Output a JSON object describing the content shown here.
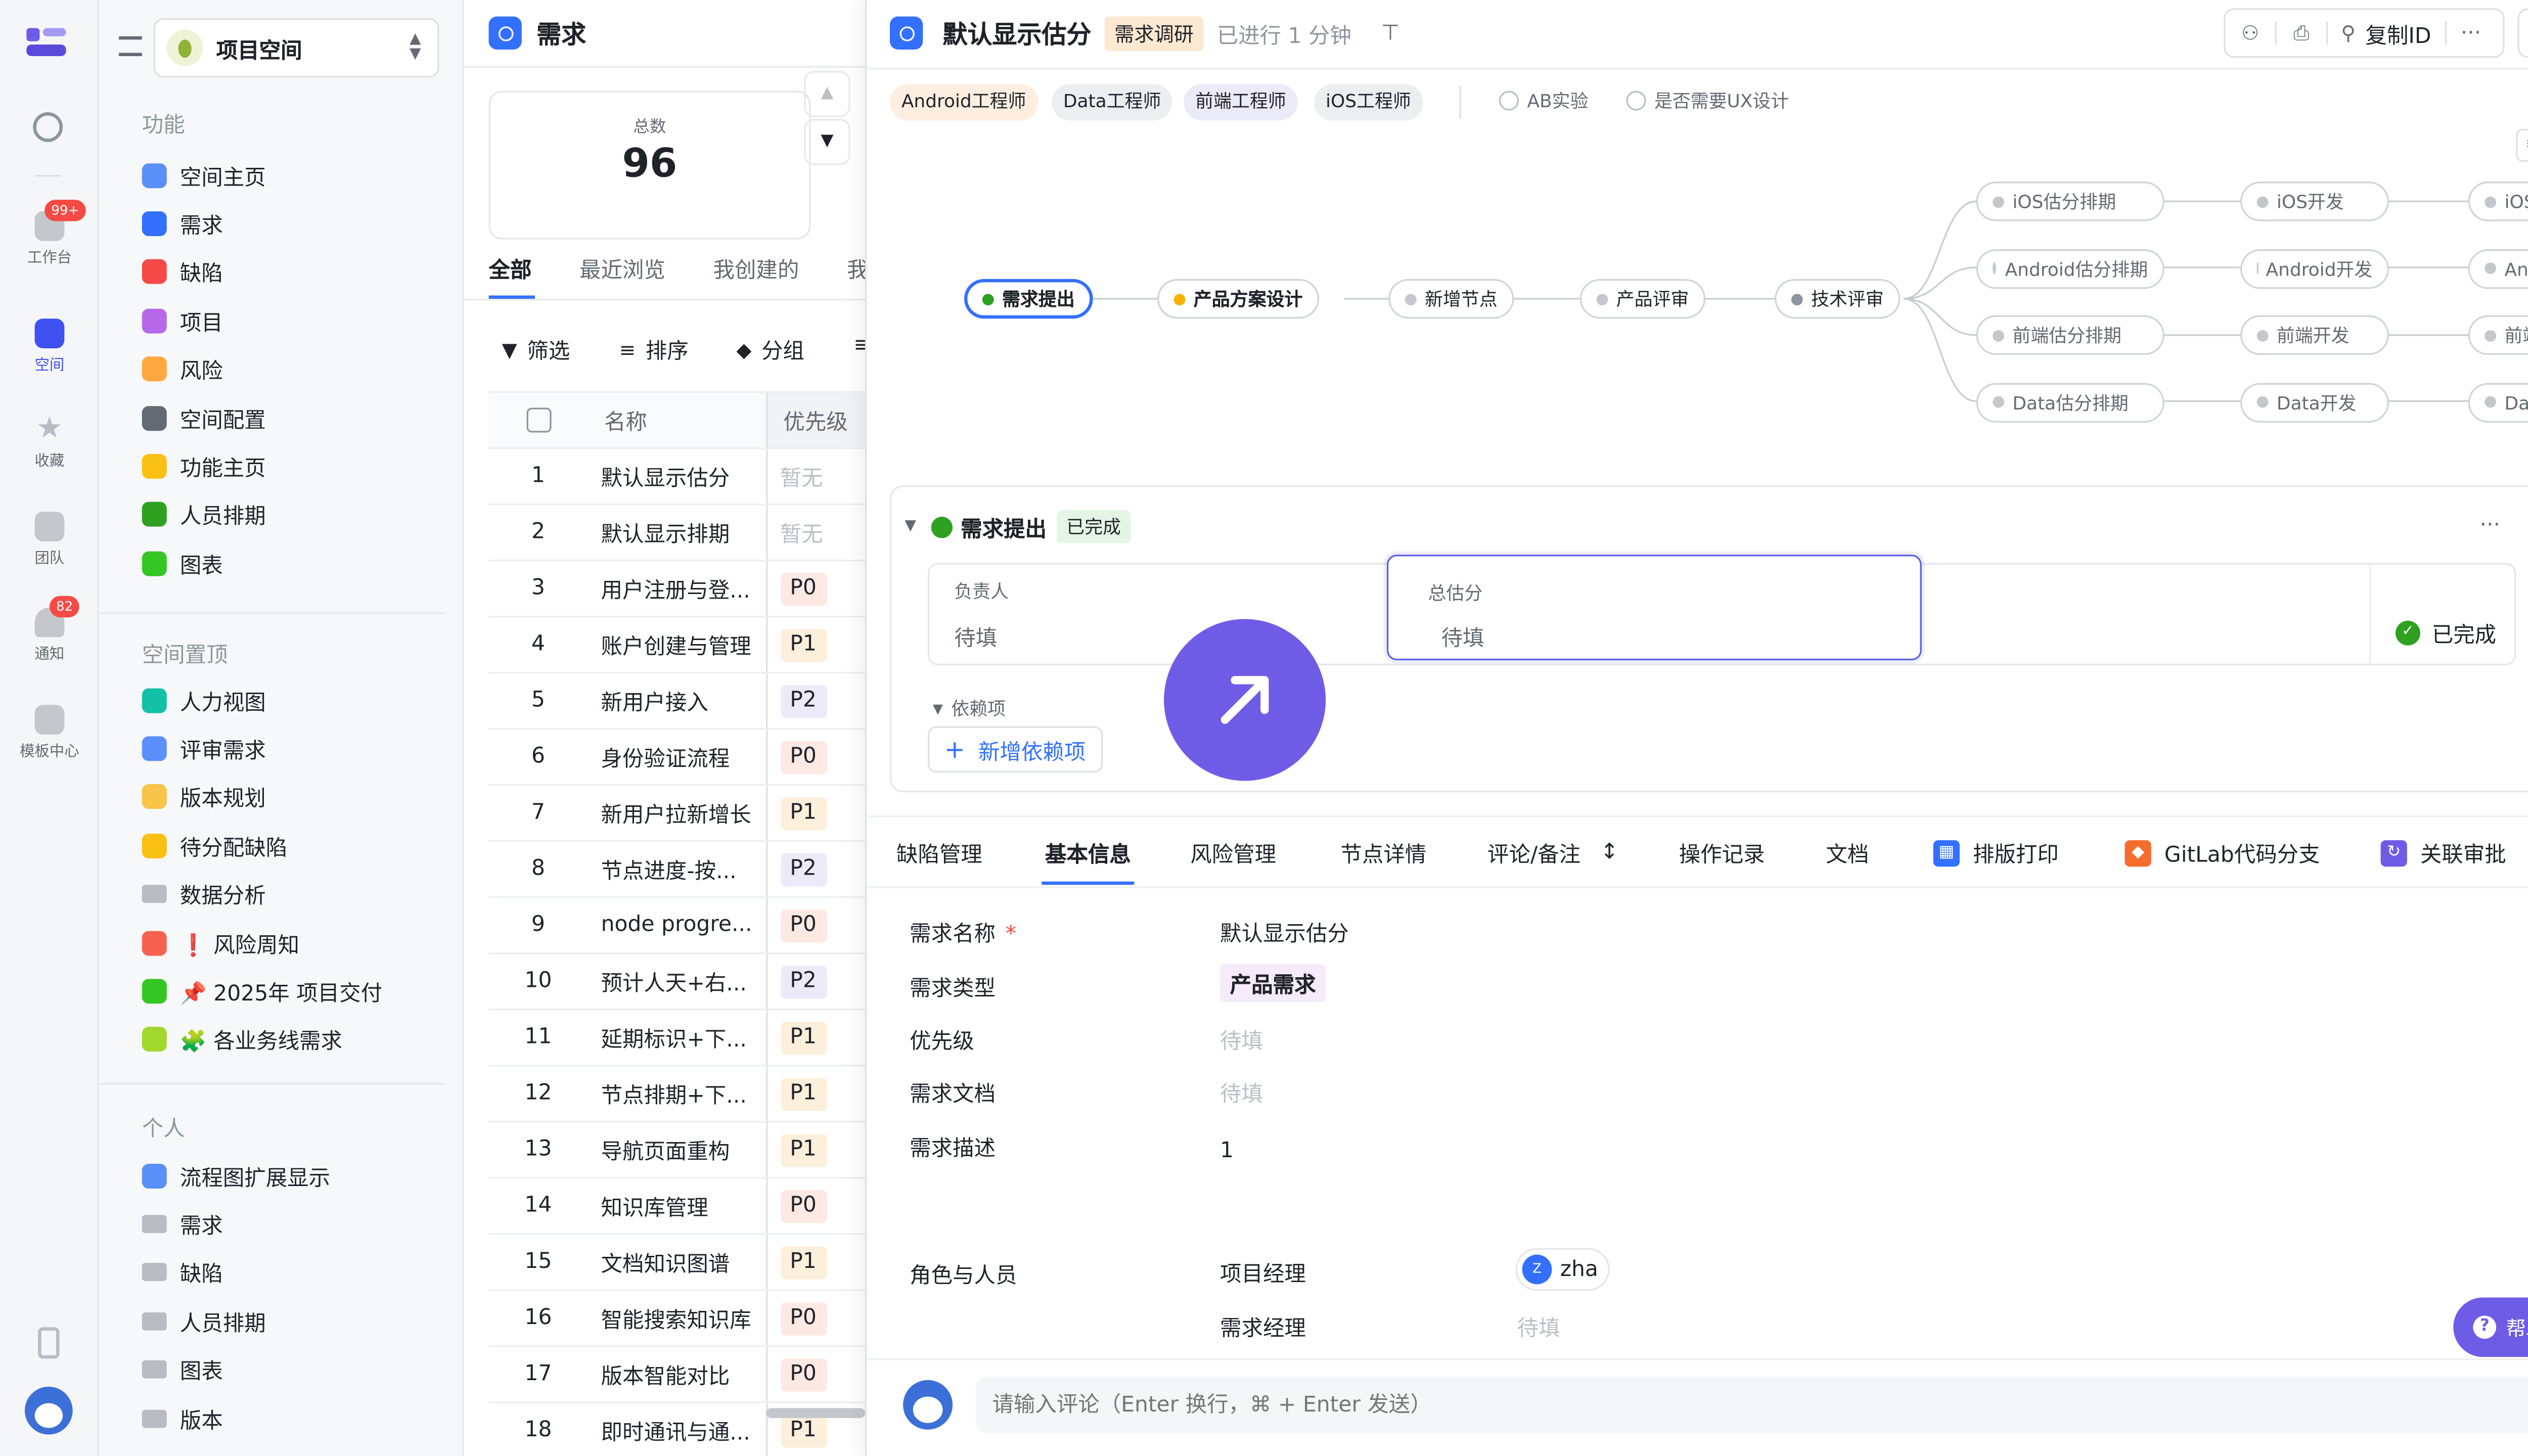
{
  "rail": {
    "items": [
      {
        "label": "工作台",
        "badge": "99+"
      },
      {
        "label": "空间"
      },
      {
        "label": "收藏"
      },
      {
        "label": "团队"
      },
      {
        "label": "通知",
        "badge": "82"
      },
      {
        "label": "模板中心"
      }
    ]
  },
  "sidebar": {
    "space_name": "项目空间",
    "func_title": "功能",
    "func_items": [
      {
        "label": "空间主页",
        "color": "#5b8ff9"
      },
      {
        "label": "需求",
        "color": "#3370ff"
      },
      {
        "label": "缺陷",
        "color": "#f54a45"
      },
      {
        "label": "项目",
        "color": "#b768e8"
      },
      {
        "label": "风险",
        "color": "#ffa940"
      },
      {
        "label": "空间配置",
        "color": "#646a73"
      },
      {
        "label": "功能主页",
        "color": "#fac014"
      },
      {
        "label": "人员排期",
        "color": "#2ea121"
      },
      {
        "label": "图表",
        "color": "#34c724"
      }
    ],
    "pinned_title": "空间置顶",
    "pinned_items": [
      {
        "label": "人力视图",
        "color": "#14c0a8"
      },
      {
        "label": "评审需求",
        "color": "#5b8ff9"
      },
      {
        "label": "版本规划",
        "color": "#f8c449"
      },
      {
        "label": "待分配缺陷",
        "color": "#fac014"
      },
      {
        "label": "数据分析",
        "folder": true
      },
      {
        "label": "❗ 风险周知",
        "color": "#f76250"
      },
      {
        "label": "📌 2025年 项目交付",
        "color": "#34c724"
      },
      {
        "label": "🧩 各业务线需求",
        "color": "#a2d72e"
      }
    ],
    "personal_title": "个人",
    "personal_items": [
      {
        "label": "流程图扩展显示",
        "color": "#5b8ff9"
      },
      {
        "label": "需求",
        "folder": true
      },
      {
        "label": "缺陷",
        "folder": true
      },
      {
        "label": "人员排期",
        "folder": true
      },
      {
        "label": "图表",
        "folder": true
      },
      {
        "label": "版本",
        "folder": true
      }
    ]
  },
  "list": {
    "title": "需求",
    "total_label": "总数",
    "total": "96",
    "tabs": [
      "全部",
      "最近浏览",
      "我创建的",
      "我"
    ],
    "toolbar": [
      "筛选",
      "排序",
      "分组"
    ],
    "headers": {
      "name": "名称",
      "priority": "优先级"
    },
    "rows": [
      {
        "no": "1",
        "name": "默认显示估分",
        "pri": "暂无"
      },
      {
        "no": "2",
        "name": "默认显示排期",
        "pri": "暂无"
      },
      {
        "no": "3",
        "name": "用户注册与登...",
        "pri": "P0"
      },
      {
        "no": "4",
        "name": "账户创建与管理",
        "pri": "P1"
      },
      {
        "no": "5",
        "name": "新用户接入",
        "pri": "P2"
      },
      {
        "no": "6",
        "name": "身份验证流程",
        "pri": "P0"
      },
      {
        "no": "7",
        "name": "新用户拉新增长",
        "pri": "P1"
      },
      {
        "no": "8",
        "name": "节点进度-按...",
        "pri": "P2"
      },
      {
        "no": "9",
        "name": "node progre...",
        "pri": "P0"
      },
      {
        "no": "10",
        "name": "预计人天+右...",
        "pri": "P2"
      },
      {
        "no": "11",
        "name": "延期标识+下...",
        "pri": "P1"
      },
      {
        "no": "12",
        "name": "节点排期+下...",
        "pri": "P1"
      },
      {
        "no": "13",
        "name": "导航页面重构",
        "pri": "P1"
      },
      {
        "no": "14",
        "name": "知识库管理",
        "pri": "P0"
      },
      {
        "no": "15",
        "name": "文档知识图谱",
        "pri": "P1"
      },
      {
        "no": "16",
        "name": "智能搜索知识库",
        "pri": "P0"
      },
      {
        "no": "17",
        "name": "版本智能对比",
        "pri": "P0"
      },
      {
        "no": "18",
        "name": "即时通讯与通...",
        "pri": "P1"
      }
    ]
  },
  "detail": {
    "title": "默认显示估分",
    "status": "需求调研",
    "elapsed": "已进行 1 分钟",
    "copy_id": "复制ID",
    "tags": [
      "Android工程师",
      "Data工程师",
      "前端工程师",
      "iOS工程师"
    ],
    "checks": [
      "AB实验",
      "是否需要UX设计"
    ],
    "flow": {
      "main": [
        "需求提出",
        "产品方案设计",
        "新增节点",
        "产品评审",
        "技术评审"
      ],
      "branches": [
        [
          "iOS估分排期",
          "iOS开发",
          "iOS测试"
        ],
        [
          "Android估分排期",
          "Android开发",
          "Android测"
        ],
        [
          "前端估分排期",
          "前端开发",
          "前端测试"
        ],
        [
          "Data估分排期",
          "Data开发",
          "Data测试"
        ]
      ]
    },
    "node_panel": {
      "name": "需求提出",
      "state": "已完成",
      "owner_label": "负责人",
      "owner_val": "待填",
      "estimate_label": "总估分",
      "estimate_val": "待填",
      "done": "已完成",
      "deps_label": "依赖项",
      "add_dep": "新增依赖项"
    },
    "tabs": [
      "缺陷管理",
      "基本信息",
      "风险管理",
      "节点详情",
      "评论/备注",
      "操作记录",
      "文档",
      "排版打印",
      "GitLab代码分支",
      "关联审批"
    ],
    "fields": {
      "name_label": "需求名称",
      "name_val": "默认显示估分",
      "type_label": "需求类型",
      "type_val": "产品需求",
      "pri_label": "优先级",
      "pri_val": "待填",
      "doc_label": "需求文档",
      "doc_val": "待填",
      "desc_label": "需求描述",
      "desc_val": "1",
      "roles_label": "角色与人员",
      "pm_label": "项目经理",
      "pm_avatar": "Z",
      "pm_val": "zha",
      "rm_label": "需求经理",
      "rm_val": "待填"
    },
    "comment_placeholder": "请输入评论（Enter 换行，⌘ + Enter 发送）",
    "help": "帮助"
  }
}
